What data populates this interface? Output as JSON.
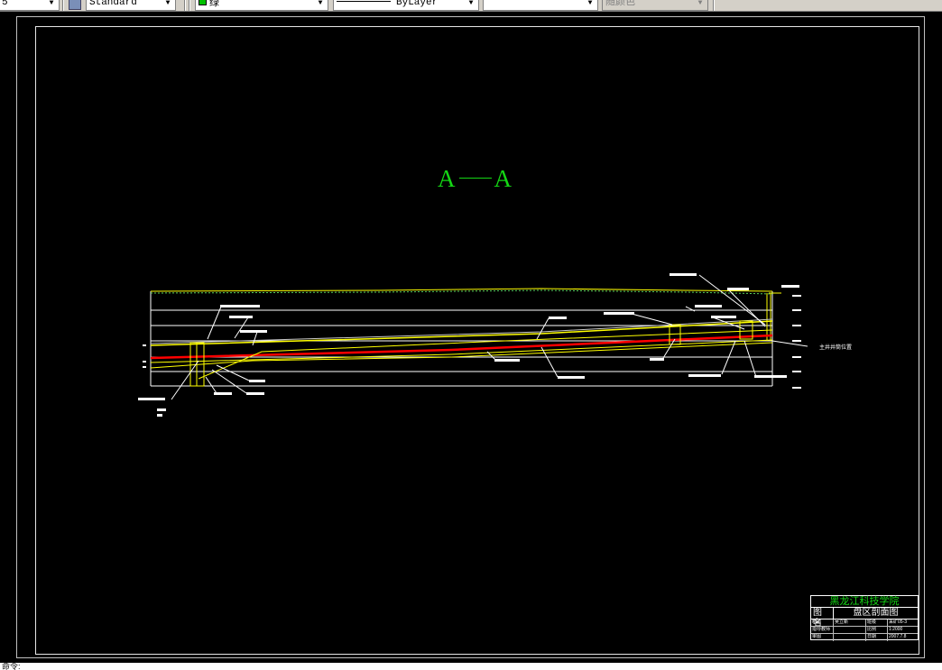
{
  "toolbar": {
    "layer_combo_value": "5",
    "text_style_value": "Standard",
    "color_value": "绿",
    "color_hex": "#00c000",
    "linetype_value": "ByLayer",
    "lineweight_value": "",
    "plotstyle_value": "随颜色"
  },
  "drawing": {
    "section_title_left": "A",
    "section_title_right": "A",
    "annotation": "主井井筒位置",
    "title_color": "#14d614",
    "line_yellow": "#ffff00",
    "line_red": "#ff0000"
  },
  "title_block": {
    "school": "黑龙江科技学院",
    "name_label": "图名",
    "name_value": "盘区剖面图",
    "rows": [
      [
        "制图",
        "吴立新",
        "班级",
        "采矿05-3"
      ],
      [
        "指导教师",
        "",
        "比例",
        "1:2000"
      ],
      [
        "审图",
        "",
        "日期",
        "2007.7.8"
      ]
    ]
  },
  "command_line": "命令:"
}
